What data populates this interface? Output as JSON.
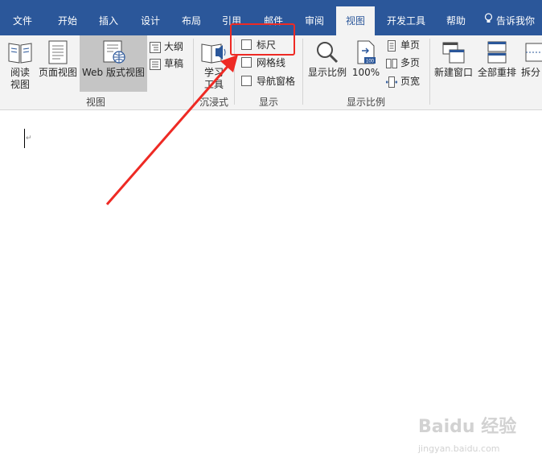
{
  "tabs": [
    {
      "label": "文件"
    },
    {
      "label": "开始"
    },
    {
      "label": "插入"
    },
    {
      "label": "设计"
    },
    {
      "label": "布局"
    },
    {
      "label": "引用"
    },
    {
      "label": "邮件"
    },
    {
      "label": "审阅"
    },
    {
      "label": "视图",
      "active": true
    },
    {
      "label": "开发工具"
    },
    {
      "label": "帮助"
    }
  ],
  "tell_me": "告诉我你",
  "ribbon": {
    "views": {
      "group_label": "视图",
      "read_mode": [
        "阅读",
        "视图"
      ],
      "print_layout": "页面视图",
      "web_layout": "Web 版式视图",
      "outline": "大纲",
      "draft": "草稿"
    },
    "immersive": {
      "group_label": "沉浸式",
      "learning_tools": [
        "学习",
        "工具"
      ]
    },
    "show": {
      "group_label": "显示",
      "ruler": "标尺",
      "gridlines": "网格线",
      "nav_pane": "导航窗格",
      "ruler_checked": false,
      "gridlines_checked": false,
      "nav_pane_checked": false
    },
    "zoom": {
      "group_label": "显示比例",
      "zoom": "显示比例",
      "hundred": "100%",
      "one_page": "单页",
      "multiple_pages": "多页",
      "page_width": "页宽"
    },
    "window": {
      "new_window": "新建窗口",
      "arrange_all": "全部重排",
      "split": "拆分"
    }
  },
  "document": {
    "paragraph_mark": "↵"
  },
  "watermark": {
    "brand": "Baidu 经验",
    "url": "jingyan.baidu.com"
  },
  "colors": {
    "tab_bar": "#2b579a",
    "ribbon": "#f3f3f3",
    "highlight": "#ee2a24",
    "arrow": "#ee2a24"
  }
}
